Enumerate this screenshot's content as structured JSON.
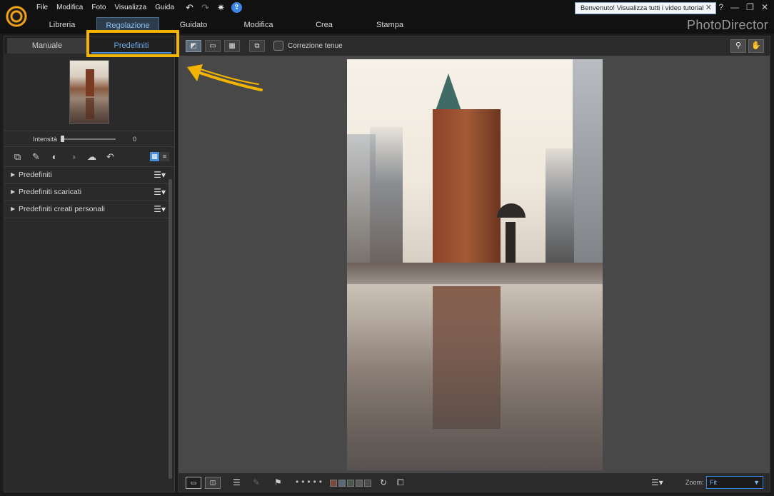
{
  "menubar": {
    "items": [
      "File",
      "Modifica",
      "Foto",
      "Visualizza",
      "Guida"
    ],
    "tutorial_text": "Benvenuto! Visualizza tutti i video tutorial qui!",
    "close_glyph": "✕",
    "help_glyph": "?",
    "minimize_glyph": "—",
    "restore_glyph": "❐",
    "window_close_glyph": "✕"
  },
  "modules": {
    "tabs": [
      "Libreria",
      "Regolazione",
      "Guidato",
      "Modifica",
      "Crea",
      "Stampa"
    ],
    "active": "Regolazione"
  },
  "brand": "PhotoDirector",
  "left_panel": {
    "tabs": {
      "manual": "Manuale",
      "presets": "Predefiniti"
    },
    "intensity_label": "Intensità",
    "intensity_value": "0",
    "preset_sections": [
      "Predefiniti",
      "Predefiniti scaricati",
      "Predefiniti creati personali"
    ]
  },
  "view_toolbar": {
    "soft_correction_label": "Correzione tenue"
  },
  "bottom_bar": {
    "zoom_label": "Zoom:",
    "zoom_value": "Fit"
  },
  "colors": {
    "accent": "#4a8fd8",
    "highlight": "#f2b400",
    "swatches": [
      "#7a4a3a",
      "#5a6a7a",
      "#4a5a4a",
      "#5a5a5a",
      "#4a4a4a"
    ]
  },
  "icons": {
    "undo": "undo-icon",
    "redo": "redo-icon",
    "settings": "gear-icon",
    "update": "update-icon"
  }
}
